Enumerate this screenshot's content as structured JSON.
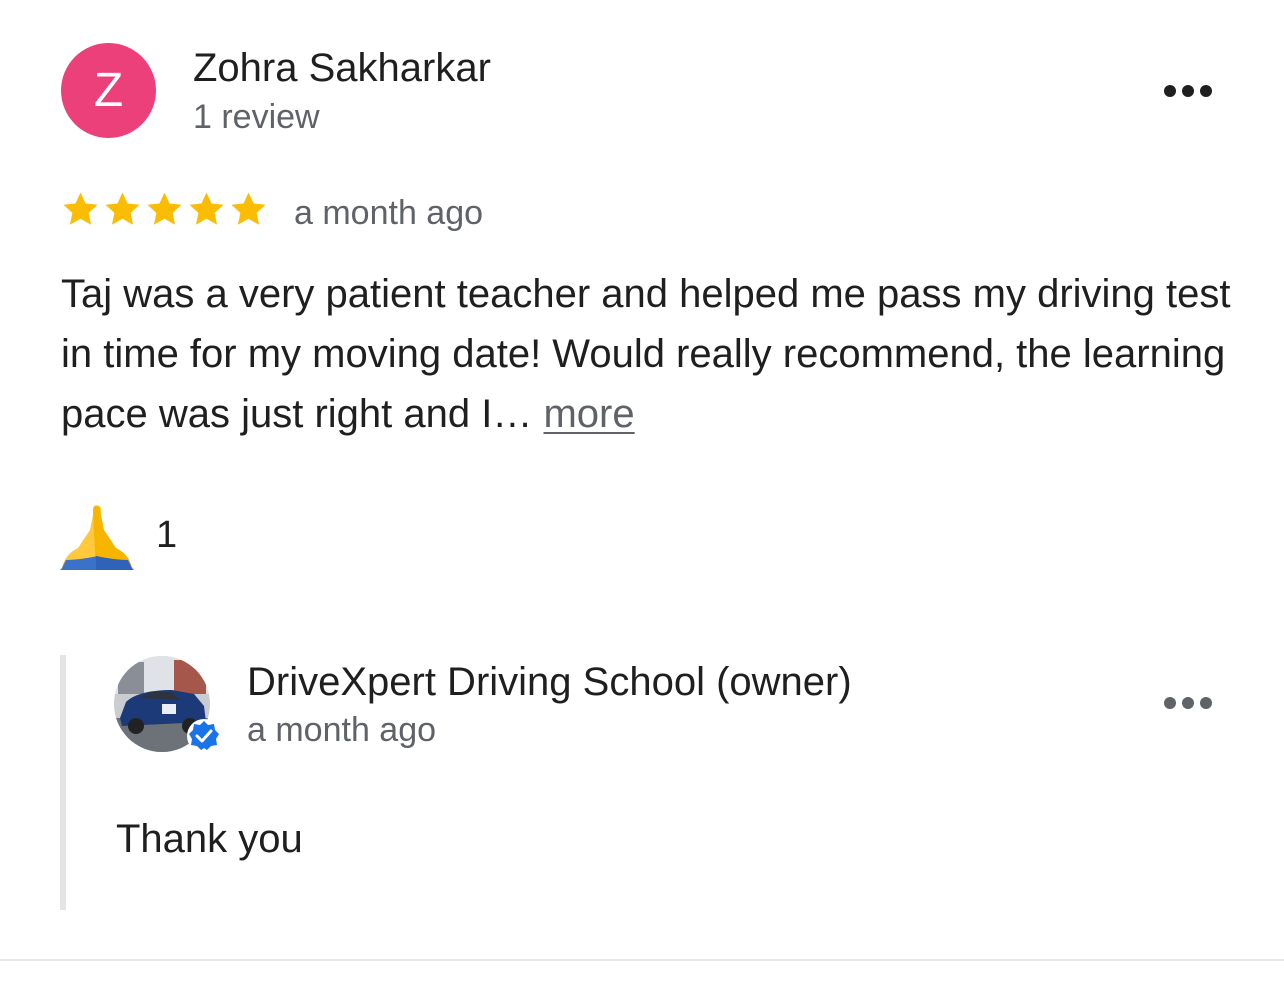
{
  "reviewer": {
    "initial": "Z",
    "avatar_color": "#ec407a",
    "name": "Zohra Sakharkar",
    "review_count": "1 review"
  },
  "review": {
    "rating": 5,
    "rating_max": 5,
    "star_color": "#fbbc04",
    "time": "a month ago",
    "text": "Taj was a very patient teacher and helped me pass my driving test in time for my moving date! Would really recommend, the learning pace was just right and I…",
    "more_label": "more"
  },
  "reaction": {
    "emoji_icon": "folded-hands-emoji",
    "count": "1"
  },
  "owner_reply": {
    "name": "DriveXpert Driving School (owner)",
    "time": "a month ago",
    "text": "Thank you",
    "verified_color": "#1a73e8"
  },
  "icons": {
    "menu": "more-horizontal-icon",
    "verified": "verified-badge-icon",
    "star": "star-icon"
  }
}
